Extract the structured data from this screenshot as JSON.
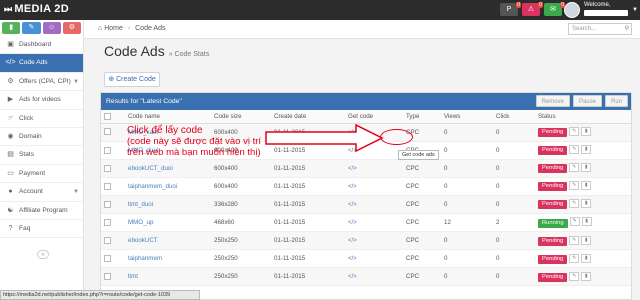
{
  "brand": "MEDIA 2D",
  "topbar": {
    "badges": [
      {
        "icon": "p-icon",
        "count": "0"
      },
      {
        "icon": "notification-icon",
        "count": "0"
      },
      {
        "icon": "mail-icon",
        "count": "0"
      }
    ],
    "welcome": "Welcome,"
  },
  "sidebar": {
    "items": [
      {
        "label": "Dashboard",
        "icon": "dashboard-icon"
      },
      {
        "label": "Code Ads",
        "icon": "code-icon",
        "active": true
      },
      {
        "label": "Offers (CPA, CPI)",
        "icon": "offers-icon",
        "arrow": true
      },
      {
        "label": "Ads for videos",
        "icon": "video-icon"
      },
      {
        "label": "Click",
        "icon": "click-icon"
      },
      {
        "label": "Domain",
        "icon": "globe-icon"
      },
      {
        "label": "Stats",
        "icon": "stats-icon"
      },
      {
        "label": "Payment",
        "icon": "payment-icon"
      },
      {
        "label": "Account",
        "icon": "user-icon",
        "arrow": true
      },
      {
        "label": "Affiliate Program",
        "icon": "affiliate-icon"
      },
      {
        "label": "Faq",
        "icon": "help-icon"
      }
    ]
  },
  "breadcrumb": {
    "home": "Home",
    "current": "Code Ads"
  },
  "search": {
    "placeholder": "Search..."
  },
  "page": {
    "title": "Code Ads",
    "subtitle": "» Code Stats"
  },
  "create_button": "Create Code",
  "panel": {
    "title": "Results for \"Latest Code\"",
    "buttons": [
      "Remove",
      "Pause",
      "Run"
    ]
  },
  "table": {
    "headers": [
      "",
      "Code name",
      "Code size",
      "Create date",
      "Get code",
      "Type",
      "Views",
      "Click",
      "Status"
    ],
    "rows": [
      {
        "name": "MMO_xam",
        "size": "600x400",
        "date": "01-11-2015",
        "type": "CPC",
        "views": "0",
        "click": "0",
        "status": "Pending"
      },
      {
        "name": "MMO_duoi",
        "size": "600x400",
        "date": "01-11-2015",
        "type": "CPC",
        "views": "0",
        "click": "0",
        "status": "Pending"
      },
      {
        "name": "ebookUCT_duoi",
        "size": "600x400",
        "date": "01-11-2015",
        "type": "CPC",
        "views": "0",
        "click": "0",
        "status": "Pending"
      },
      {
        "name": "taiphanmem_duoi",
        "size": "600x400",
        "date": "01-11-2015",
        "type": "CPC",
        "views": "0",
        "click": "0",
        "status": "Pending"
      },
      {
        "name": "ltmt_duoi",
        "size": "336x280",
        "date": "01-11-2015",
        "type": "CPC",
        "views": "0",
        "click": "0",
        "status": "Pending"
      },
      {
        "name": "MMO_up",
        "size": "468x60",
        "date": "01-11-2015",
        "type": "CPC",
        "views": "12",
        "click": "2",
        "status": "Running"
      },
      {
        "name": "ebookUCT",
        "size": "250x250",
        "date": "01-11-2015",
        "type": "CPC",
        "views": "0",
        "click": "0",
        "status": "Pending"
      },
      {
        "name": "taiphanmem",
        "size": "250x250",
        "date": "01-11-2015",
        "type": "CPC",
        "views": "0",
        "click": "0",
        "status": "Pending"
      },
      {
        "name": "ltmt",
        "size": "250x250",
        "date": "01-11-2015",
        "type": "CPC",
        "views": "0",
        "click": "0",
        "status": "Pending"
      }
    ]
  },
  "annotation": {
    "line1": "Click để lấy code",
    "line2": "(code này sẽ được đặt vào vị trí",
    "line3": "trên web mà bạn muốn hiện thị)"
  },
  "tooltip": "Get code ads",
  "statusbar": "https://media2d.net/publisher/index.php?r=route/code/get-code-1039",
  "colors": {
    "accent": "#3a6fb0",
    "pending": "#d9345f",
    "running": "#3aa84b",
    "annotation": "#e3001b"
  }
}
